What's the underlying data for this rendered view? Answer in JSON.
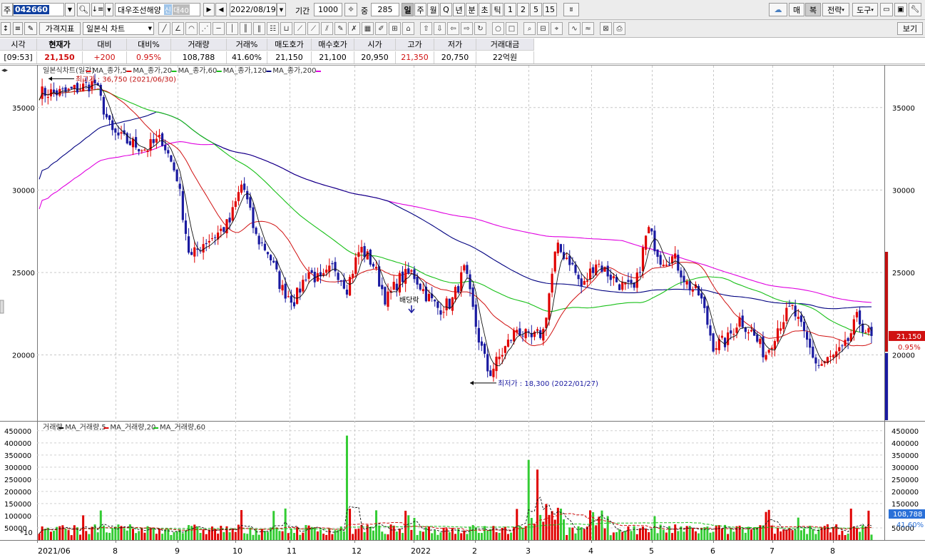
{
  "toolbar": {
    "code_label": "주",
    "stock_code": "042660",
    "stock_name": "대우조선해양",
    "badge_credit": "신",
    "badge_margin": "대40",
    "date": "2022/08/19",
    "period_label": "기간",
    "period_value": "1000",
    "count_label": "중",
    "count_value": "285",
    "periods": [
      "일",
      "주",
      "월",
      "Q",
      "년",
      "분",
      "초",
      "틱",
      "1",
      "2",
      "5",
      "15"
    ],
    "active_period": "일",
    "right_buttons": [
      "매",
      "복",
      "전략",
      "도구"
    ]
  },
  "toolbar2": {
    "indicator_label": "가격지표",
    "chart_type": "일본식 차트",
    "view_label": "보기"
  },
  "quote": {
    "headers": [
      "시각",
      "현재가",
      "대비",
      "대비%",
      "거래량",
      "거래%",
      "매도호가",
      "매수호가",
      "시가",
      "고가",
      "저가",
      "거래대금"
    ],
    "values": [
      "[09:53]",
      "21,150",
      "+200",
      "0.95%",
      "108,788",
      "41.60%",
      "21,150",
      "21,100",
      "20,950",
      "21,350",
      "20,750",
      "22억원"
    ]
  },
  "price_panel": {
    "legend": [
      {
        "text": "일본식차트(일간)",
        "color": "#000000"
      },
      {
        "text": "MA_종가,5",
        "color": "#e00000"
      },
      {
        "text": "MA_종가,20",
        "color": "#e00000"
      },
      {
        "text": "MA_종가,60",
        "color": "#18c018"
      },
      {
        "text": "MA_종가,120",
        "color": "#18c018"
      },
      {
        "text": "MA_종가,200",
        "color": "#000080"
      }
    ],
    "legend_end_color": "#e000e0",
    "y_ticks": [
      "35000",
      "30000",
      "25000",
      "20000"
    ],
    "high_annotation": "최고가 : 36,750 (2021/06/30)",
    "low_annotation": "최저가 : 18,300 (2022/01/27)",
    "dividend_label": "배당락",
    "current_price_tag": "21,150",
    "current_pct_tag": "0.95%"
  },
  "volume_panel": {
    "legend": [
      {
        "text": "거래량",
        "color": "#e00000"
      },
      {
        "text": "MA_거래량,5",
        "color": "#000000"
      },
      {
        "text": "MA_거래량,20",
        "color": "#e00000"
      },
      {
        "text": "MA_거래량,60",
        "color": "#18c018"
      }
    ],
    "y_ticks": [
      "450000",
      "400000",
      "350000",
      "300000",
      "250000",
      "200000",
      "150000",
      "100000",
      "50000"
    ],
    "scale_note": "*10",
    "current_volume_tag": "108,788",
    "current_pct_tag": "41.60%"
  },
  "x_axis": [
    "2021/06",
    "8",
    "9",
    "10",
    "11",
    "12",
    "2022",
    "2",
    "3",
    "4",
    "5",
    "6",
    "7",
    "8"
  ],
  "colors": {
    "up": "#e00000",
    "down": "#1a1aa0",
    "volume_up": "#e00000",
    "volume_down": "#33cc33",
    "ma60": "#18c018",
    "ma120": "#000080",
    "ma200": "#e000e0"
  },
  "chart_data": {
    "type": "candlestick",
    "x_range": [
      "2021/06",
      "2022/08/19"
    ],
    "ylim": [
      16000,
      37500
    ],
    "close_series": [
      {
        "x": "2021/06/14",
        "y": 35900
      },
      {
        "x": "2021/06/30",
        "y": 36500
      },
      {
        "x": "2021/07/09",
        "y": 33500
      },
      {
        "x": "2021/07/16",
        "y": 33000
      },
      {
        "x": "2021/07/27",
        "y": 32500
      },
      {
        "x": "2021/08/05",
        "y": 33100
      },
      {
        "x": "2021/08/13",
        "y": 30800
      },
      {
        "x": "2021/08/20",
        "y": 25800
      },
      {
        "x": "2021/08/27",
        "y": 26800
      },
      {
        "x": "2021/09/03",
        "y": 27300
      },
      {
        "x": "2021/09/10",
        "y": 28000
      },
      {
        "x": "2021/09/17",
        "y": 30500
      },
      {
        "x": "2021/09/24",
        "y": 27200
      },
      {
        "x": "2021/10/01",
        "y": 26200
      },
      {
        "x": "2021/10/08",
        "y": 24000
      },
      {
        "x": "2021/10/15",
        "y": 23300
      },
      {
        "x": "2021/10/22",
        "y": 25100
      },
      {
        "x": "2021/10/29",
        "y": 24400
      },
      {
        "x": "2021/11/05",
        "y": 25400
      },
      {
        "x": "2021/11/12",
        "y": 24100
      },
      {
        "x": "2021/11/19",
        "y": 26500
      },
      {
        "x": "2021/11/26",
        "y": 25500
      },
      {
        "x": "2021/12/03",
        "y": 23300
      },
      {
        "x": "2021/12/10",
        "y": 24600
      },
      {
        "x": "2021/12/17",
        "y": 25000
      },
      {
        "x": "2021/12/24",
        "y": 23700
      },
      {
        "x": "2021/12/31",
        "y": 22800
      },
      {
        "x": "2022/01/07",
        "y": 23200
      },
      {
        "x": "2022/01/14",
        "y": 25200
      },
      {
        "x": "2022/01/21",
        "y": 21200
      },
      {
        "x": "2022/01/27",
        "y": 18800
      },
      {
        "x": "2022/02/04",
        "y": 20300
      },
      {
        "x": "2022/02/11",
        "y": 21600
      },
      {
        "x": "2022/02/18",
        "y": 20900
      },
      {
        "x": "2022/02/25",
        "y": 21400
      },
      {
        "x": "2022/03/04",
        "y": 26500
      },
      {
        "x": "2022/03/11",
        "y": 25800
      },
      {
        "x": "2022/03/18",
        "y": 24000
      },
      {
        "x": "2022/03/25",
        "y": 25700
      },
      {
        "x": "2022/04/01",
        "y": 24900
      },
      {
        "x": "2022/04/08",
        "y": 24200
      },
      {
        "x": "2022/04/15",
        "y": 23900
      },
      {
        "x": "2022/04/22",
        "y": 27700
      },
      {
        "x": "2022/04/29",
        "y": 25800
      },
      {
        "x": "2022/05/06",
        "y": 25900
      },
      {
        "x": "2022/05/13",
        "y": 24300
      },
      {
        "x": "2022/05/20",
        "y": 23600
      },
      {
        "x": "2022/05/27",
        "y": 20600
      },
      {
        "x": "2022/06/03",
        "y": 20800
      },
      {
        "x": "2022/06/10",
        "y": 22200
      },
      {
        "x": "2022/06/17",
        "y": 21300
      },
      {
        "x": "2022/06/24",
        "y": 20000
      },
      {
        "x": "2022/07/01",
        "y": 21800
      },
      {
        "x": "2022/07/08",
        "y": 22900
      },
      {
        "x": "2022/07/15",
        "y": 21100
      },
      {
        "x": "2022/07/22",
        "y": 19300
      },
      {
        "x": "2022/07/29",
        "y": 19800
      },
      {
        "x": "2022/08/05",
        "y": 20300
      },
      {
        "x": "2022/08/12",
        "y": 22200
      },
      {
        "x": "2022/08/19",
        "y": 21150
      }
    ]
  }
}
